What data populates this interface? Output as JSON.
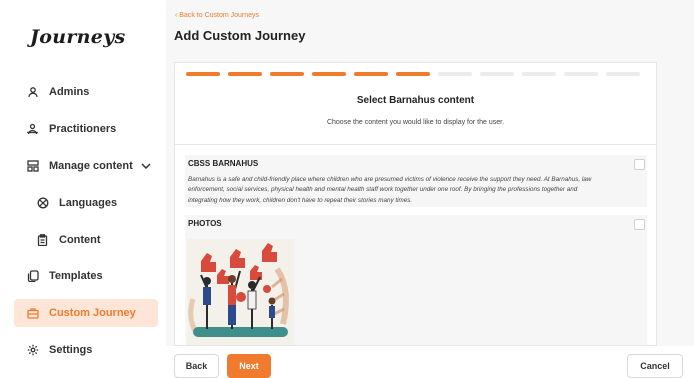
{
  "app": {
    "logo": "Journeys"
  },
  "sidebar": {
    "items": [
      {
        "label": "Admins",
        "icon": "person-icon"
      },
      {
        "label": "Practitioners",
        "icon": "people-icon"
      },
      {
        "label": "Manage content",
        "icon": "content-grid-icon",
        "expanded": true
      },
      {
        "label": "Languages",
        "icon": "globe-icon"
      },
      {
        "label": "Content",
        "icon": "clipboard-icon"
      },
      {
        "label": "Templates",
        "icon": "copy-icon"
      },
      {
        "label": "Custom Journey",
        "icon": "briefcase-icon",
        "active": true
      },
      {
        "label": "Settings",
        "icon": "gear-icon"
      }
    ]
  },
  "header": {
    "back_link": "‹ Back to Custom Journeys",
    "title": "Add Custom Journey"
  },
  "wizard": {
    "steps_total": 11,
    "steps_done": 6,
    "step_title": "Select Barnahus content",
    "step_subtitle": "Choose the content you would like to display for the user."
  },
  "sections": {
    "cbss": {
      "title": "CBSS BARNAHUS",
      "text": "Barnahus is a safe and child-friendly place where children who are presumed victims of violence receive the support they need. At Barnahus, law enforcement, social services, physical health and mental health staff work together under one roof. By bringing the professions together and integrating how they work, children don't have to repeat their stories many times.",
      "checked": false
    },
    "photos": {
      "title": "PHOTOS",
      "checked": false
    }
  },
  "footer": {
    "back_label": "Back",
    "next_label": "Next",
    "cancel_label": "Cancel"
  },
  "colors": {
    "accent": "#f07a2d",
    "active_bg": "#fde6d8",
    "step_inactive": "#ececec"
  }
}
